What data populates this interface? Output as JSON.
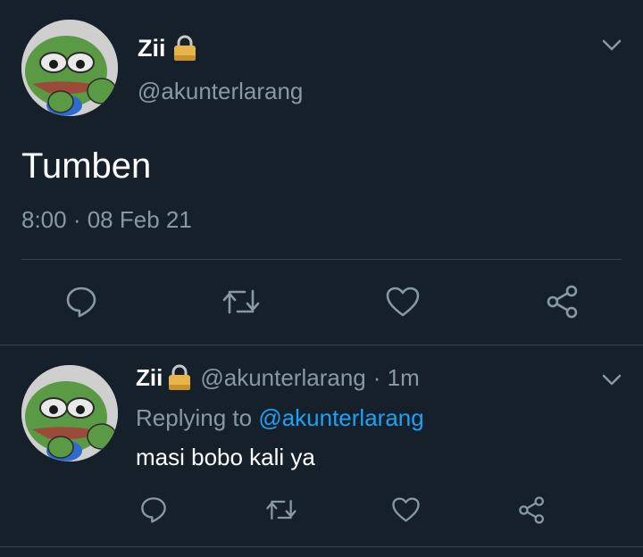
{
  "main_tweet": {
    "display_name": "Zii",
    "lock_icon": "lock-icon",
    "handle": "@akunterlarang",
    "text": "Tumben",
    "timestamp": "8:00 · 08 Feb 21",
    "menu_icon": "chevron-down-icon",
    "actions": [
      "reply-icon",
      "retweet-icon",
      "like-icon",
      "share-icon"
    ]
  },
  "reply_tweet": {
    "display_name": "Zii",
    "lock_icon": "lock-icon",
    "handle": "@akunterlarang",
    "time": "· 1m",
    "replying_prefix": "Replying to",
    "replying_handle": "@akunterlarang",
    "text": "masi bobo kali ya",
    "menu_icon": "chevron-down-icon",
    "actions": [
      "reply-icon",
      "retweet-icon",
      "like-icon",
      "share-icon"
    ]
  },
  "colors": {
    "background": "#15202b",
    "muted": "#8899a6",
    "link": "#1da1f2",
    "divider": "#38444d",
    "lock": "#e8b54b"
  }
}
